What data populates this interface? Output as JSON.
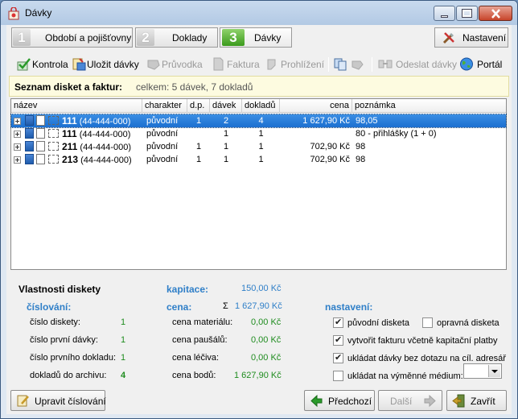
{
  "window": {
    "title": "Dávky"
  },
  "steps": [
    {
      "num": "1",
      "label": "Období a pojišťovny"
    },
    {
      "num": "2",
      "label": "Doklady"
    },
    {
      "num": "3",
      "label": "Dávky"
    }
  ],
  "settings_label": "Nastavení",
  "toolbar": {
    "kontrola": "Kontrola",
    "ulozit": "Uložit dávky",
    "pruvodka": "Průvodka",
    "faktura": "Faktura",
    "prohlizeni": "Prohlížení",
    "odeslat": "Odeslat dávky",
    "portal": "Portál"
  },
  "list": {
    "title": "Seznam disket a faktur:",
    "summary": "celkem: 5 dávek, 7 dokladů",
    "columns": [
      "název",
      "charakter",
      "d.p.",
      "dávek",
      "dokladů",
      "cena",
      "poznámka"
    ],
    "rows": [
      {
        "num": "111",
        "code": "(44-444-000)",
        "charakter": "původní",
        "dp": "1",
        "davek": "2",
        "dokladu": "4",
        "cena": "1 627,90 Kč",
        "poznamka": "98,05"
      },
      {
        "num": "111",
        "code": "(44-444-000)",
        "charakter": "původní",
        "dp": "",
        "davek": "1",
        "dokladu": "1",
        "cena": "",
        "poznamka": "80 - přihlášky (1 + 0)"
      },
      {
        "num": "211",
        "code": "(44-444-000)",
        "charakter": "původní",
        "dp": "1",
        "davek": "1",
        "dokladu": "1",
        "cena": "702,90 Kč",
        "poznamka": "98"
      },
      {
        "num": "213",
        "code": "(44-444-000)",
        "charakter": "původní",
        "dp": "1",
        "davek": "1",
        "dokladu": "1",
        "cena": "702,90 Kč",
        "poznamka": "98"
      }
    ]
  },
  "props": {
    "title": "Vlastnosti diskety",
    "cislovani": "číslování:",
    "cislo_diskety_lbl": "číslo diskety:",
    "cislo_diskety_val": "1",
    "cislo_prvni_davky_lbl": "číslo první dávky:",
    "cislo_prvni_davky_val": "1",
    "cislo_prvniho_dokladu_lbl": "číslo prvního dokladu:",
    "cislo_prvniho_dokladu_val": "1",
    "dokladu_do_archivu_lbl": "dokladů do archivu:",
    "dokladu_do_archivu_val": "4",
    "kapitace_lbl": "kapitace:",
    "kapitace_val": "150,00 Kč",
    "cena_lbl": "cena:",
    "cena_sigma": "Σ",
    "cena_val": "1 627,90 Kč",
    "cena_materialu_lbl": "cena materiálu:",
    "cena_materialu_val": "0,00 Kč",
    "cena_pausalu_lbl": "cena paušálů:",
    "cena_pausalu_val": "0,00 Kč",
    "cena_leciva_lbl": "cena léčiva:",
    "cena_leciva_val": "0,00 Kč",
    "cena_bodu_lbl": "cena bodů:",
    "cena_bodu_val": "1 627,90 Kč",
    "nastaveni": "nastavení:",
    "chk_puvodni": "původní disketa",
    "chk_opravna": "opravná disketa",
    "chk_vytvorit": "vytvořit fakturu včetně kapitační platby",
    "chk_ukladat": "ukládat dávky bez dotazu na cíl. adresář",
    "chk_medium": "ukládat na výměnné médium:"
  },
  "buttons": {
    "upravit": "Upravit číslování",
    "predchozi": "Předchozí",
    "dalsi": "Další",
    "zavrit": "Zavřít"
  }
}
